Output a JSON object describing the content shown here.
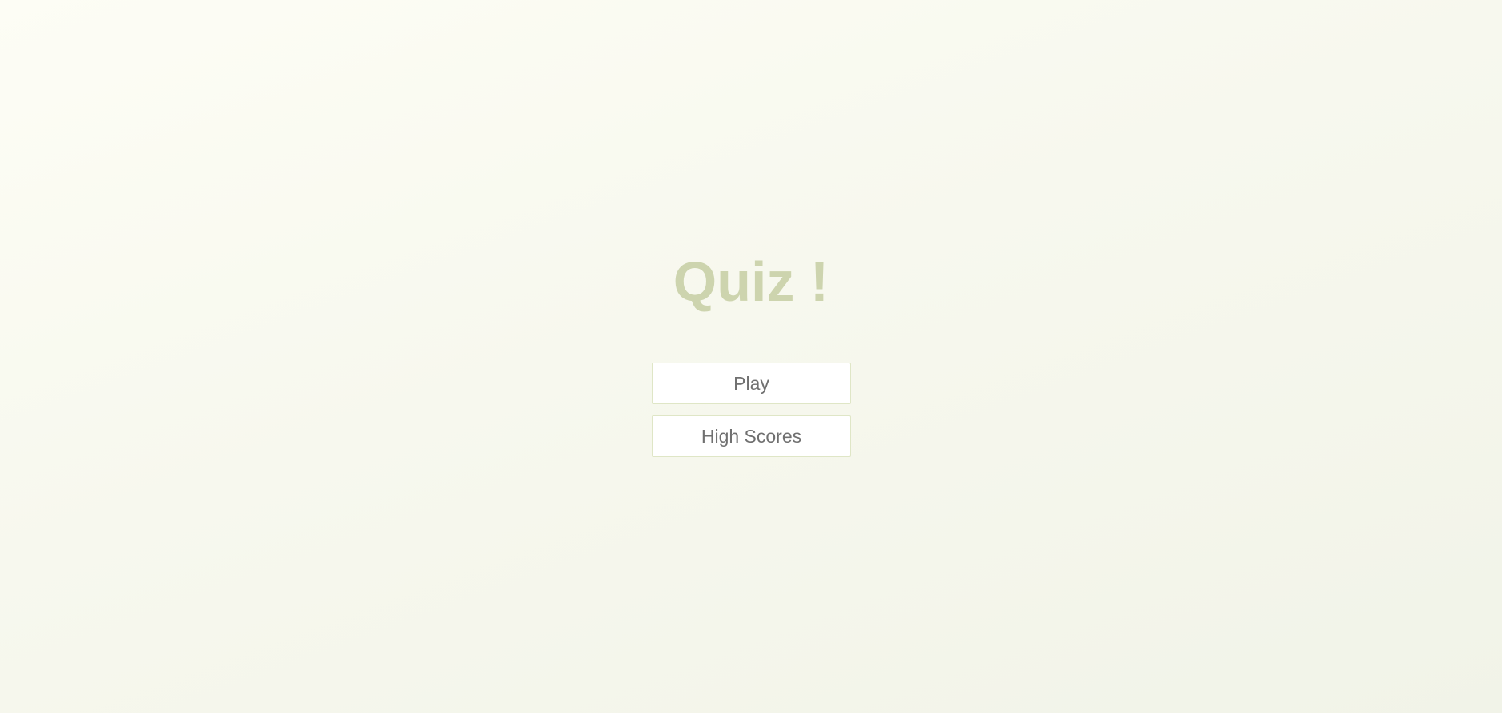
{
  "home": {
    "title": "Quiz !",
    "play_label": "Play",
    "high_scores_label": "High Scores"
  },
  "colors": {
    "title": "#cdd4ae",
    "button_border": "#dfe6c6",
    "button_text": "#707070",
    "background": "#f7f8ee"
  }
}
